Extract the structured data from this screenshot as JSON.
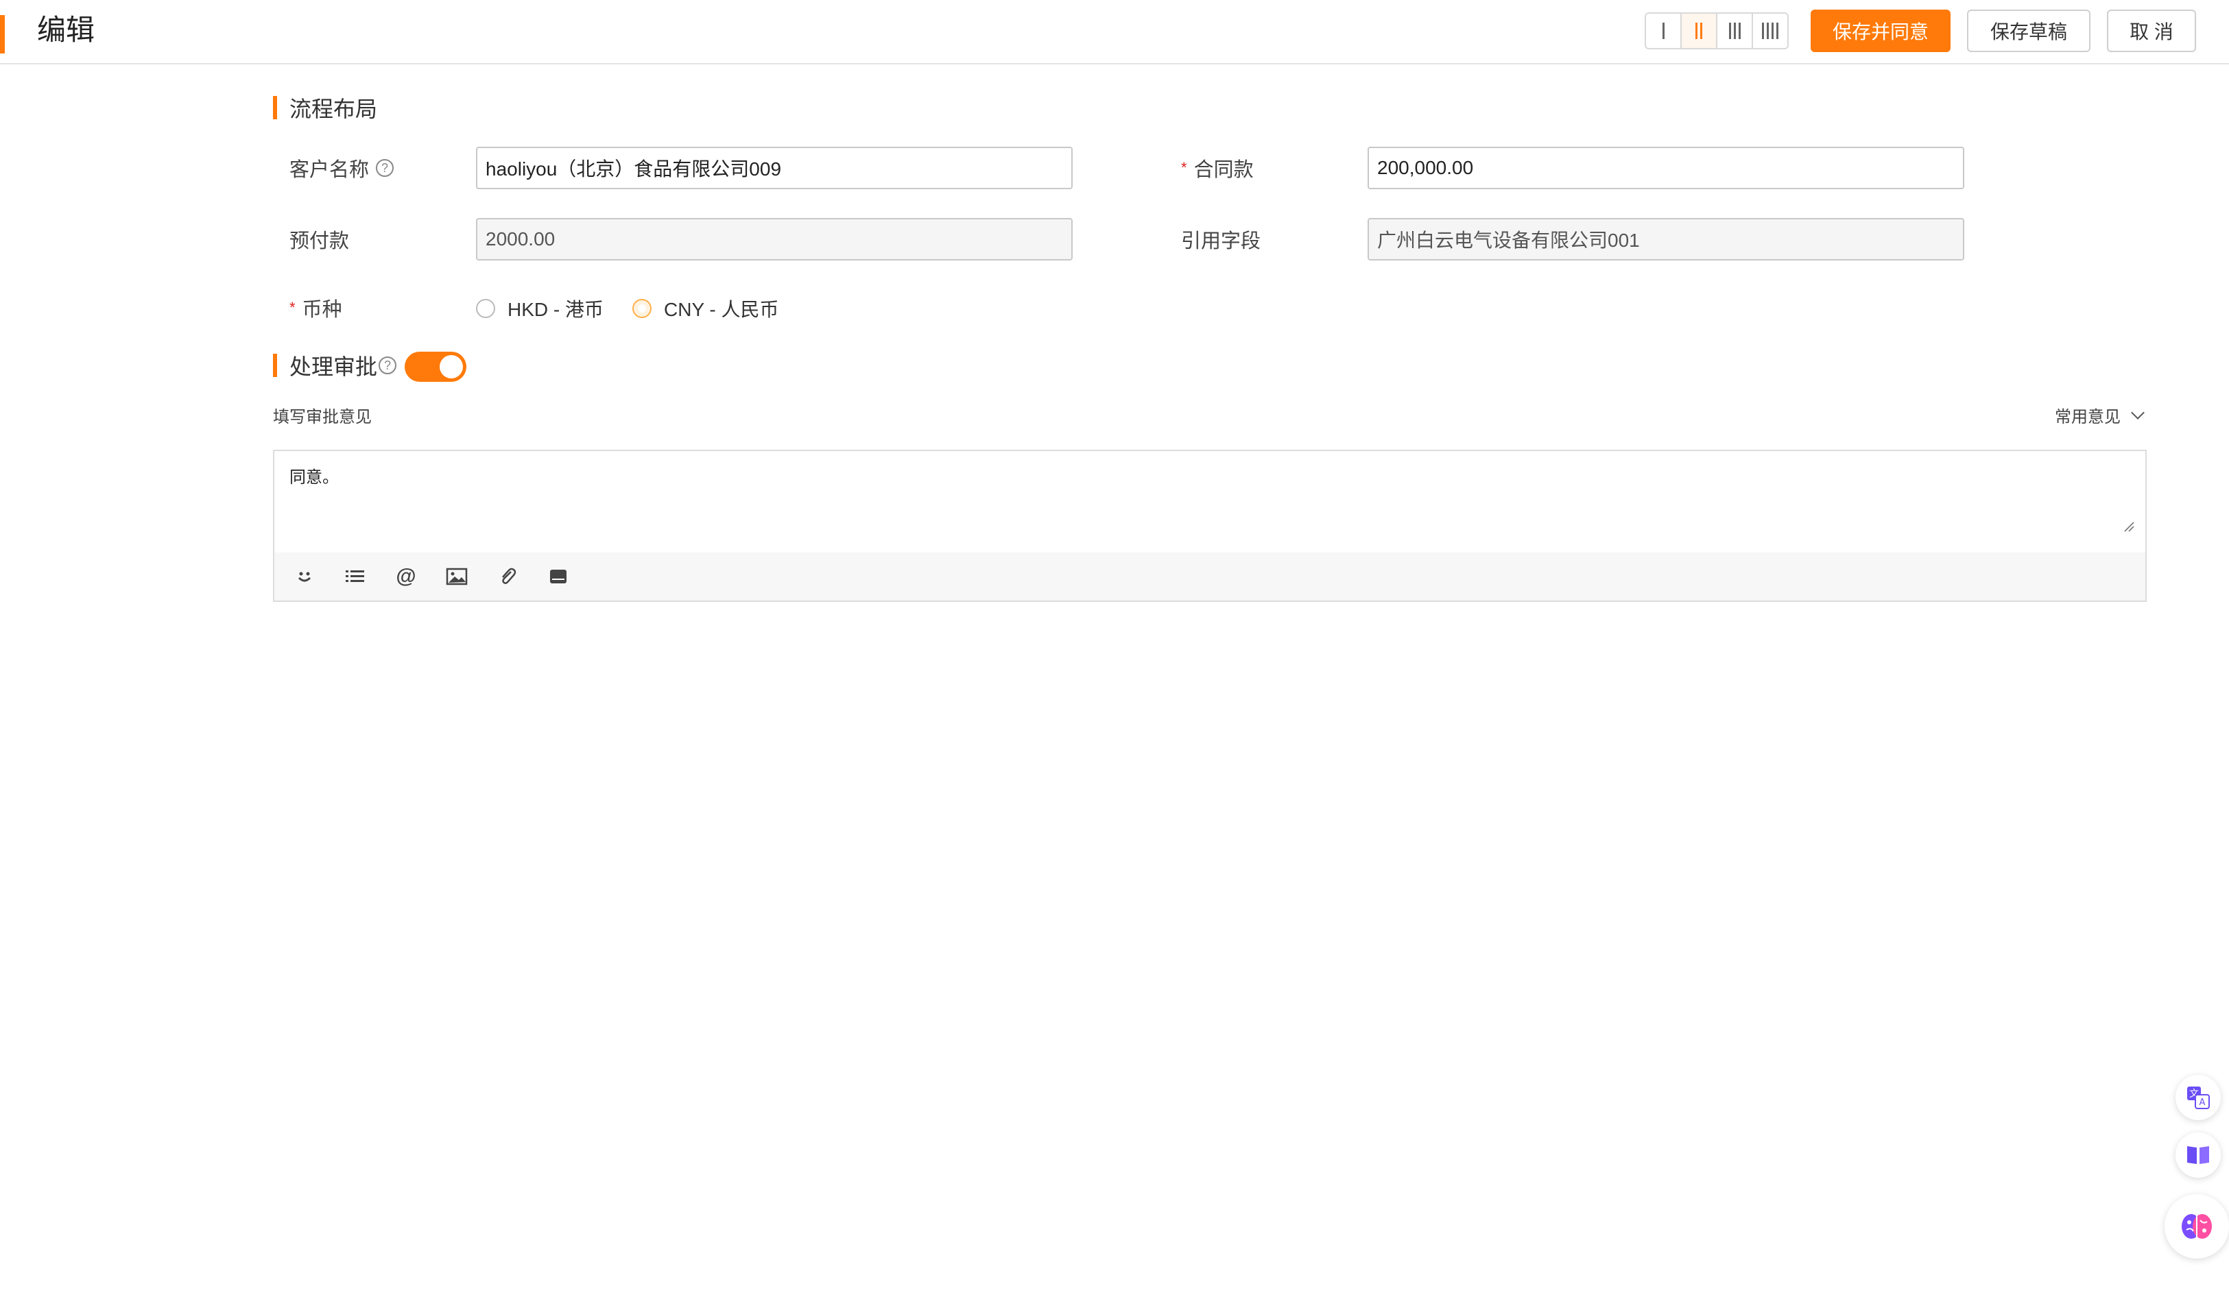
{
  "header": {
    "title": "编辑",
    "actions": {
      "save_approve": "保存并同意",
      "save_draft": "保存草稿",
      "cancel": "取 消"
    },
    "layout_columns": {
      "options": [
        1,
        2,
        3,
        4
      ],
      "selected": 2
    },
    "accent_color": "#ff7a0a"
  },
  "section_layout": {
    "title": "流程布局"
  },
  "form": {
    "customer_name": {
      "label": "客户名称",
      "value": "haoliyou（北京）食品有限公司009"
    },
    "contract_amount": {
      "label": "合同款",
      "required_mark": "*",
      "value": "200,000.00"
    },
    "prepayment": {
      "label": "预付款",
      "value": "2000.00"
    },
    "reference_field": {
      "label": "引用字段",
      "value": "广州白云电气设备有限公司001"
    },
    "currency": {
      "label": "币种",
      "required_mark": "*",
      "options": [
        {
          "label": "HKD - 港币",
          "checked": false
        },
        {
          "label": "CNY - 人民币",
          "checked": true
        }
      ]
    }
  },
  "approval": {
    "title": "处理审批",
    "enabled": true,
    "opinion_label": "填写审批意见",
    "common_opinions": "常用意见",
    "opinion_text": "同意。",
    "toolbar_icons": [
      "emoji-icon",
      "list-icon",
      "mention-icon",
      "image-icon",
      "attachment-icon",
      "keyboard-icon"
    ]
  },
  "floating": [
    "translate-icon",
    "book-icon",
    "ai-brain-icon"
  ]
}
